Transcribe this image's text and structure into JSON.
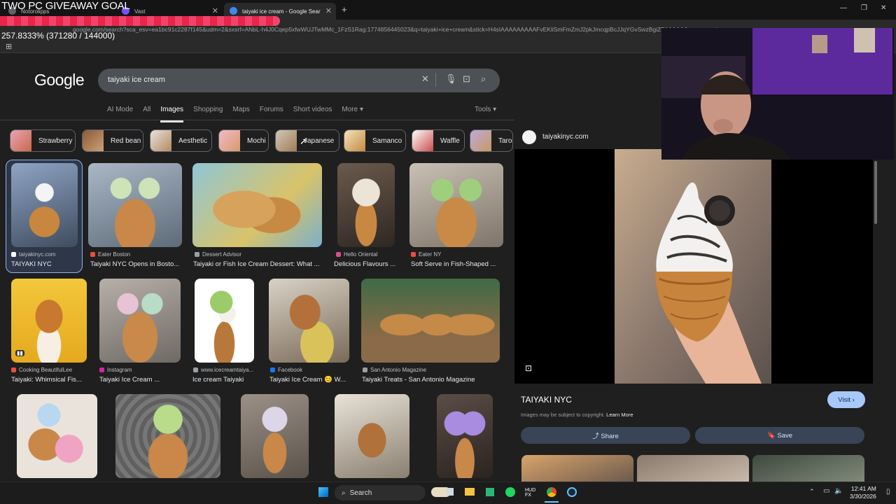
{
  "browser": {
    "tabs": [
      {
        "label": "Notorolipps"
      },
      {
        "label": "Vast"
      },
      {
        "label": "taiyaki ice cream - Google Sear..."
      }
    ],
    "url": "google.com/search?sca_esv=ea1bc91c2287f145&udm=2&sxsrf=ANbL-h4J0Cqep5xfwWUJTwMMc_1FzS1Rag:1774856445023&q=taiyaki+ice+cream&stick=H4sIAAAAAAAAAFvEKliSmFmZmJ2pkJmcqpBcJJqYGvSwzBgiZFAAAAA&source=univ"
  },
  "overlay": {
    "giveaway": "TWO PC GIVEAWAY GOAL",
    "progress_text": "257.8333% (371280 / 144000)",
    "progress_fraction": 1.0
  },
  "google": {
    "logo": "Google",
    "query": "taiyaki ice cream",
    "nav_tabs": [
      "AI Mode",
      "All",
      "Images",
      "Shopping",
      "Maps",
      "Forums",
      "Short videos",
      "More ▾"
    ],
    "tools": "Tools ▾",
    "chips": [
      "Strawberry",
      "Red bean",
      "Aesthetic",
      "Mochi",
      "Japanese",
      "Samanco",
      "Waffle",
      "Taro"
    ]
  },
  "results": [
    {
      "source": "taiyakinyc.com",
      "title": "TAIYAKI NYC"
    },
    {
      "source": "Eater Boston",
      "title": "Taiyaki NYC Opens in Bosto..."
    },
    {
      "source": "Dessert Advisor",
      "title": "Taiyaki or Fish Ice Cream Dessert: What ..."
    },
    {
      "source": "Hello Oriental",
      "title": "Delicious Flavours ..."
    },
    {
      "source": "Eater NY",
      "title": "Soft Serve in Fish-Shaped ..."
    },
    {
      "source": "Cooking BeautifulLee",
      "title": "Taiyaki: Whimsical Fis..."
    },
    {
      "source": "Instagram",
      "title": "Taiyaki Ice Cream ..."
    },
    {
      "source": "www.icecreamtaiya...",
      "title": "Ice cream Taiyaki"
    },
    {
      "source": "Facebook",
      "title": "Taiyaki Ice Cream 😊 W..."
    },
    {
      "source": "San Antonio Magazine",
      "title": "Taiyaki Treats - San Antonio Magazine"
    }
  ],
  "panel": {
    "site": "taiyakinyc.com",
    "title": "TAIYAKI NYC",
    "copyright": "Images may be subject to copyright.",
    "learn_more": "Learn More",
    "visit": "Visit ›",
    "share": "⤴ Share",
    "save": "🔖 Save"
  },
  "taskbar": {
    "search": "Search",
    "time": "12:41 AM",
    "date": "3/30/2026"
  }
}
